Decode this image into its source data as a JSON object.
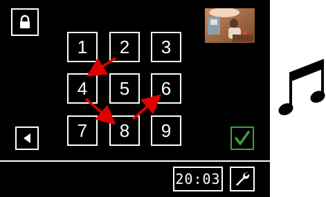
{
  "screen": {
    "lock_icon": "padlock-icon",
    "thumbnail": "scene-thumbnail",
    "keypad": [
      "1",
      "2",
      "3",
      "4",
      "5",
      "6",
      "7",
      "8",
      "9"
    ],
    "back_icon": "left-arrow-icon",
    "confirm_icon": "checkmark-icon",
    "time": "20:03",
    "settings_icon": "wrench-icon",
    "pattern_color": "#e00000",
    "confirm_color": "#3fa33f"
  },
  "decoration": {
    "icon": "music-notes-icon"
  }
}
